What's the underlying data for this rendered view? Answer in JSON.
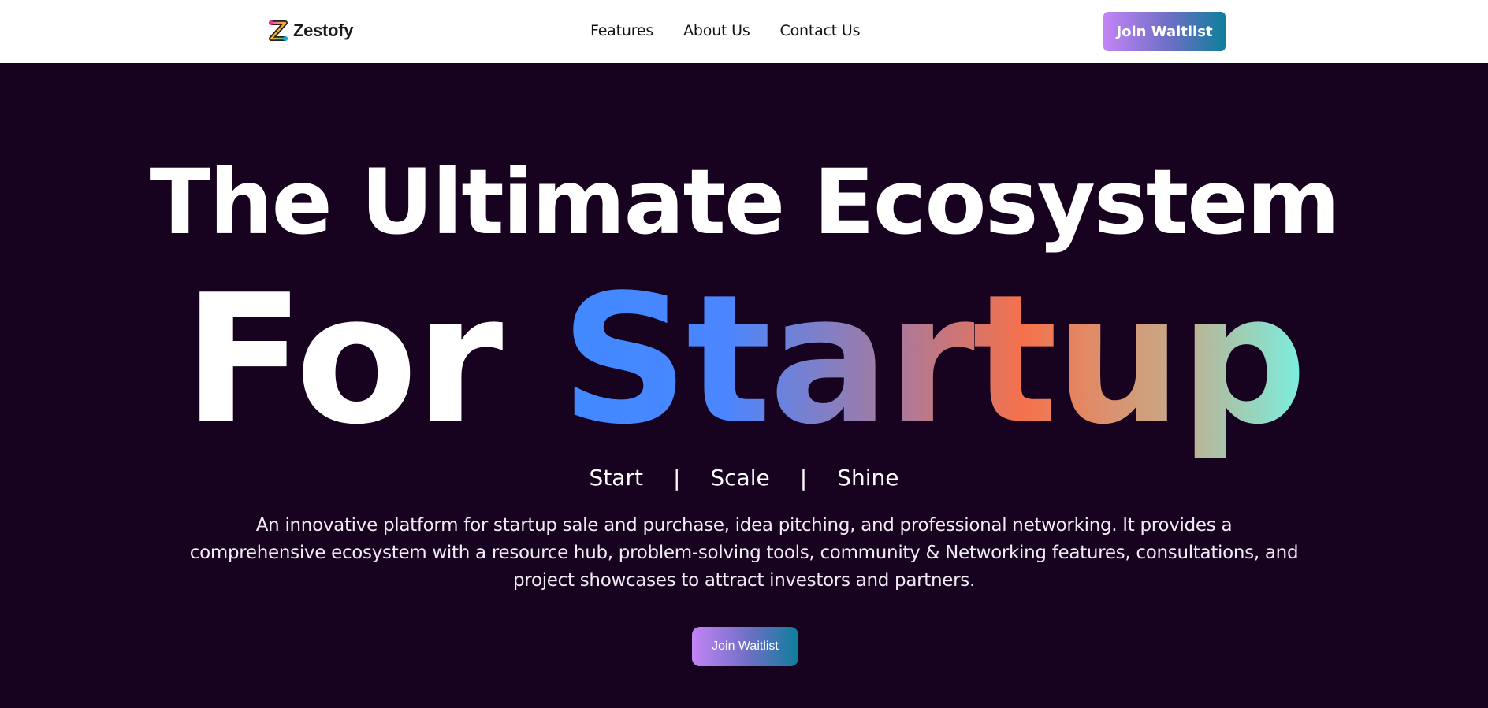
{
  "brand": {
    "name": "Zestofy",
    "icon": "zestofy-logo-icon"
  },
  "nav": {
    "links": [
      "Features",
      "About Us",
      "Contact Us"
    ],
    "cta_label": "Join Waitlist"
  },
  "hero": {
    "title_line1": "The Ultimate Ecosystem",
    "title_line2_plain": "For ",
    "title_line2_gradient": "Startup",
    "tagline": [
      "Start",
      "Scale",
      "Shine"
    ],
    "tagline_separator": "|",
    "description": "An innovative platform for startup sale and purchase, idea pitching, and professional networking. It provides a comprehensive ecosystem with a resource hub, problem-solving tools, community & Networking features, consultations, and project showcases to attract investors and partners.",
    "cta_label": "Join Waitlist"
  },
  "colors": {
    "hero_background": "#170220",
    "button_gradient": [
      "#c384f6",
      "#6b6fc4",
      "#0e7f9c"
    ],
    "title_gradient": [
      "#4189ff",
      "#a87a9c",
      "#f5714c",
      "#c8a886",
      "#78f0e0"
    ]
  }
}
